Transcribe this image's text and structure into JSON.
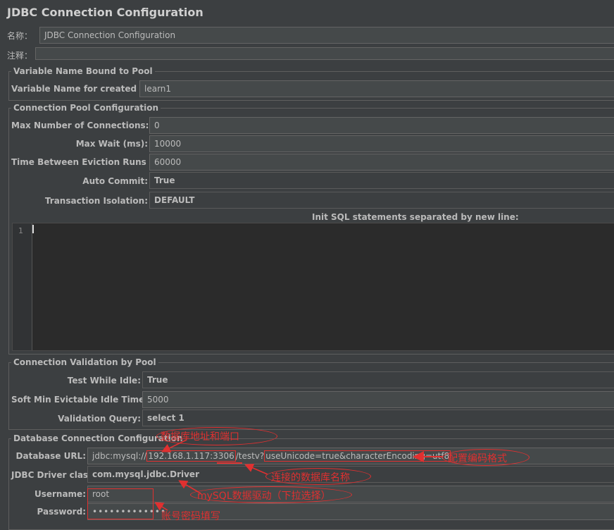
{
  "title": "JDBC Connection Configuration",
  "name": {
    "label": "名称：",
    "value": "JDBC Connection Configuration"
  },
  "comment": {
    "label": "注释：",
    "value": ""
  },
  "pool_binding": {
    "legend": "Variable Name Bound to Pool",
    "label": "Variable Name for created pool:",
    "value": "learn1"
  },
  "pool_config": {
    "legend": "Connection Pool Configuration",
    "max_conn_label": "Max Number of Connections:",
    "max_conn_value": "0",
    "max_wait_label": "Max Wait (ms):",
    "max_wait_value": "10000",
    "eviction_label": "Time Between Eviction Runs (ms):",
    "eviction_value": "60000",
    "auto_commit_label": "Auto Commit:",
    "auto_commit_value": "True",
    "isolation_label": "Transaction Isolation:",
    "isolation_value": "DEFAULT",
    "init_sql_label": "Init SQL statements separated by new line:",
    "line_number": "1"
  },
  "validation": {
    "legend": "Connection Validation by Pool",
    "test_idle_label": "Test While Idle:",
    "test_idle_value": "True",
    "soft_min_label": "Soft Min Evictable Idle Time(ms):",
    "soft_min_value": "5000",
    "query_label": "Validation Query:",
    "query_value": "select 1"
  },
  "db_config": {
    "legend": "Database Connection Configuration",
    "url_label": "Database URL:",
    "url_prefix": "jdbc:mysql://",
    "url_host": "192.168.1.117:3306",
    "url_slash": "/",
    "url_db": "testv?",
    "url_params": "useUnicode=true&characterEncoding=utf8",
    "driver_label": "JDBC Driver class:",
    "driver_value": "com.mysql.jdbc.Driver",
    "username_label": "Username:",
    "username_value": "root",
    "password_label": "Password:",
    "password_value": "•••••••••••••"
  },
  "annotations": {
    "host_note": "数据库地址和端口",
    "encoding_note": "配置编码格式",
    "dbname_note": "连接的数据库名称",
    "driver_note": "mySQL数据驱动（下拉选择）",
    "account_note": "账号密码填写"
  },
  "colors": {
    "annotation": "#e03030",
    "background": "#3c3f41"
  }
}
